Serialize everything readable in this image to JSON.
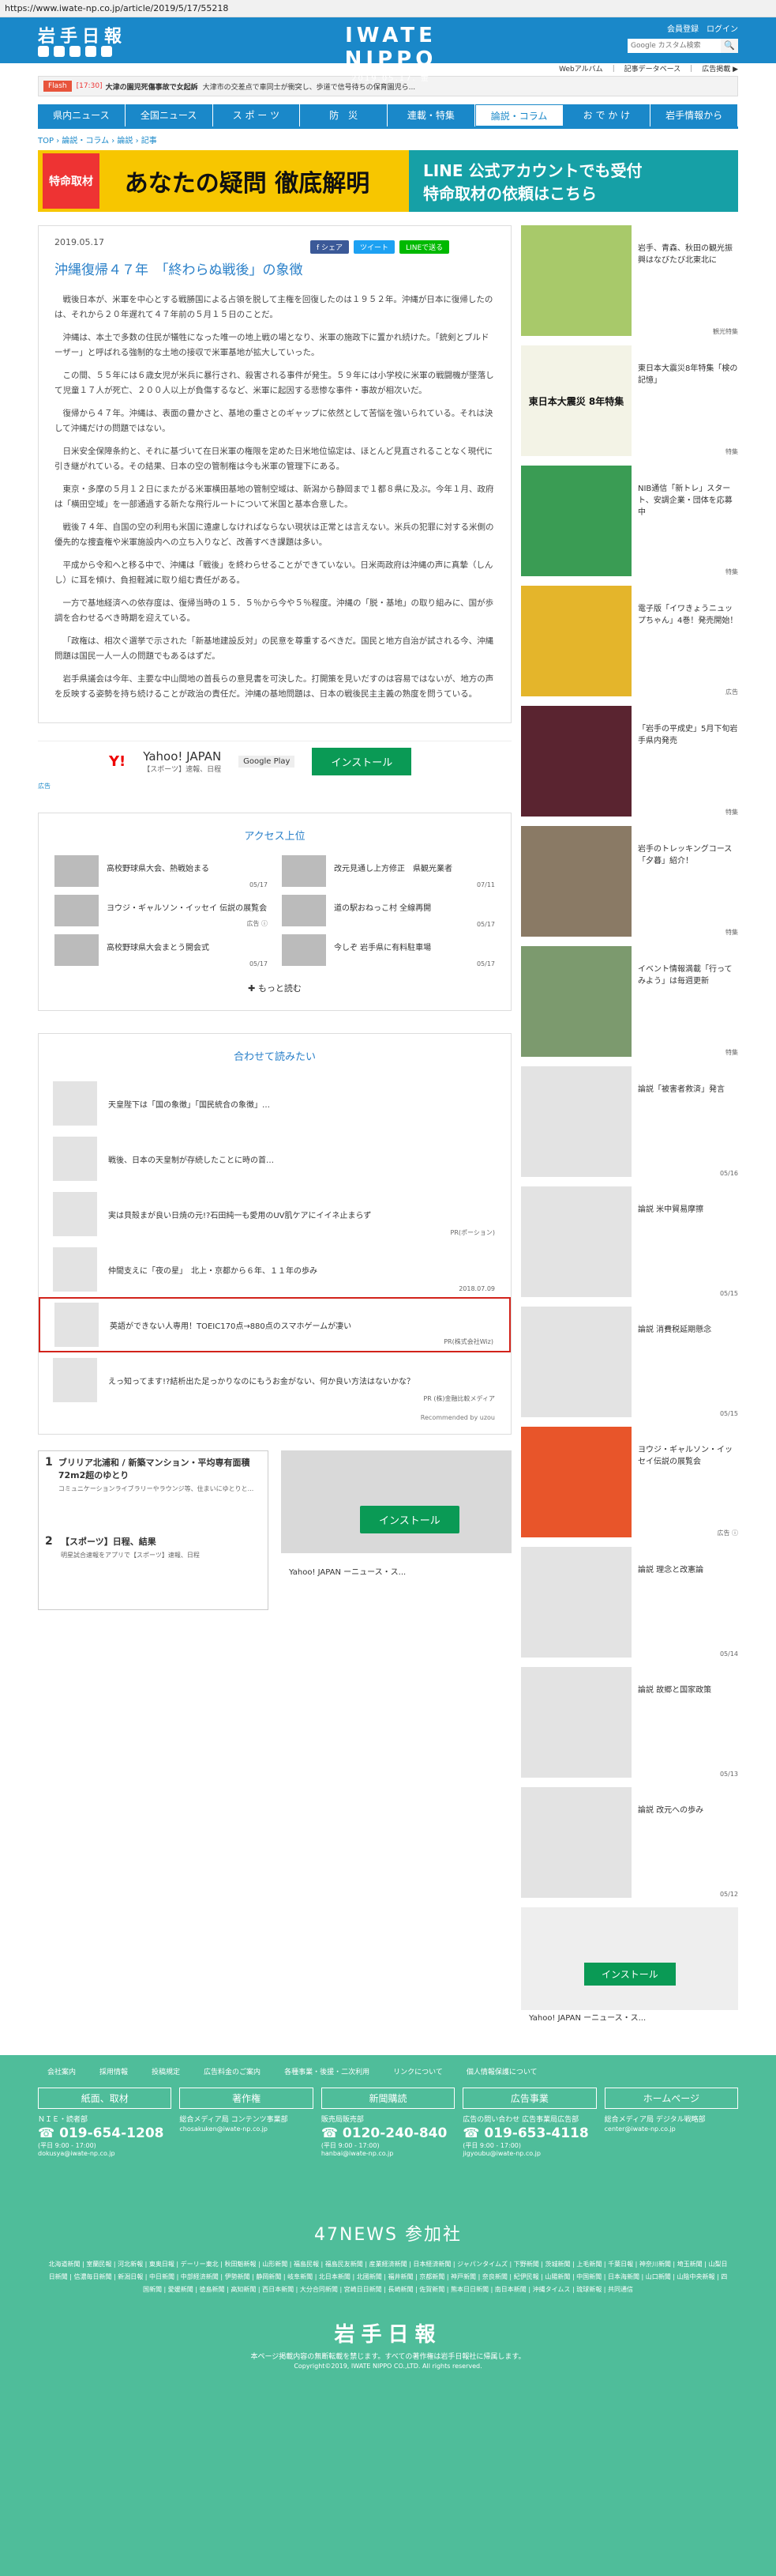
{
  "url": "https://www.iwate-np.co.jp/article/2019/5/17/55218",
  "header": {
    "logo": "岩手日報",
    "name": "IWATE NIPPO",
    "date": "2019.05.17. 金",
    "member": "会員登録　ログイン",
    "search_placeholder": "Google カスタム検索",
    "search_btn": "🔍"
  },
  "subbar": "Webアルバム　｜　記事データベース　｜　広告掲載 ▶",
  "flash": {
    "tag": "Flash",
    "time": "[17:30]",
    "title": "大津の園児死傷事故で女起訴",
    "body": "大津市の交差点で車同士が衝突し、歩道で信号待ちの保育園児ら..."
  },
  "nav": [
    {
      "label": "県内ニュース"
    },
    {
      "label": "全国ニュース"
    },
    {
      "label": "ス ポ ー ツ"
    },
    {
      "label": "防　災"
    },
    {
      "label": "連載・特集"
    },
    {
      "label": "論説・コラム",
      "active": true
    },
    {
      "label": "お で か け"
    },
    {
      "label": "岩手情報から"
    }
  ],
  "breadcrumb": "TOP › 論説・コラム › 論説 › 記事",
  "banner": {
    "q": "特命取材",
    "main": "あなたの疑問 徹底解明",
    "r1": "LINE 公式アカウントでも受付",
    "r2": "特命取材の依頼はこちら"
  },
  "article": {
    "date": "2019.05.17",
    "share": [
      "f シェア",
      "ツイート",
      "LINEで送る"
    ],
    "title": "沖縄復帰４７年　「終わらぬ戦後」の象徴",
    "paras": [
      "戦後日本が、米軍を中心とする戦勝国による占領を脱して主権を回復したのは１９５２年。沖縄が日本に復帰したのは、それから２０年遅れて４７年前の５月１５日のことだ。",
      "沖縄は、本土で多数の住民が犠牲になった唯一の地上戦の場となり、米軍の施政下に置かれ続けた。「銃剣とブルドーザー」と呼ばれる強制的な土地の接収で米軍基地が拡大していった。",
      "この間、５５年には６歳女児が米兵に暴行され、殺害される事件が発生。５９年には小学校に米軍の戦闘機が墜落して児童１７人が死亡、２００人以上が負傷するなど、米軍に起因する悲惨な事件・事故が相次いだ。",
      "復帰から４７年。沖縄は、表面の豊かさと、基地の重さとのギャップに依然として苦悩を強いられている。それは決して沖縄だけの問題ではない。",
      "日米安全保障条約と、それに基づいて在日米軍の権限を定めた日米地位協定は、ほとんど見直されることなく現代に引き継がれている。その結果、日本の空の管制権は今も米軍の管理下にある。",
      "東京・多摩の５月１２日にまたがる米軍横田基地の管制空域は、新潟から静岡まで１都８県に及ぶ。今年１月、政府は「横田空域」を一部通過する新たな飛行ルートについて米国と基本合意した。",
      "戦後７４年、自国の空の利用も米国に遠慮しなければならない現状は正常とは言えない。米兵の犯罪に対する米側の優先的な捜査権や米軍施設内への立ち入りなど、改善すべき課題は多い。",
      "平成から令和へと移る中で、沖縄は「戦後」を終わらせることができていない。日米両政府は沖縄の声に真摯（しんし）に耳を傾け、負担軽減に取り組む責任がある。",
      "一方で基地経済への依存度は、復帰当時の１５．５％から今や５％程度。沖縄の「脱・基地」の取り組みに、国が歩調を合わせるべき時期を迎えている。",
      "「政権は、相次ぐ選挙で示された「新基地建設反対」の民意を尊重するべきだ。国民と地方自治が試される今、沖縄問題は国民一人一人の問題でもあるはずだ。",
      "岩手県議会は今年、主要な中山間地の首長らの意見書を可決した。打開策を見いだすのは容易ではないが、地方の声を反映する姿勢を持ち続けることが政治の責任だ。沖縄の基地問題は、日本の戦後民主主義の熟度を問うている。"
    ]
  },
  "ad1": {
    "brand": "Y!",
    "title": "Yahoo! JAPAN",
    "sub": "【スポーツ】速報、日程",
    "gp": "Google Play",
    "install": "インストール",
    "label": "広告"
  },
  "access": {
    "heading": "アクセス上位",
    "items": [
      {
        "text": "高校野球県大会、熱戦始まる",
        "date": "05/17"
      },
      {
        "text": "改元見通し上方修正　県観光業者",
        "date": "07/11"
      },
      {
        "text": "ヨウジ・ギャルソン・イッセイ 伝説の展覧会",
        "date": "広告 ⓘ"
      },
      {
        "text": "道の駅おねっこ村 全線再開",
        "date": "05/17"
      },
      {
        "text": "高校野球県大会まとう開会式",
        "date": "05/17"
      },
      {
        "text": "今しぞ 岩手県に有料駐車場",
        "date": "05/17"
      }
    ],
    "more": "✚ もっと読む"
  },
  "related": {
    "heading": "合わせて読みたい",
    "items": [
      {
        "text": "天皇陛下は「国の象徴」「国民統合の象徴」…",
        "sponsor": ""
      },
      {
        "text": "戦後、日本の天皇制が存続したことに時の首…",
        "sponsor": ""
      },
      {
        "text": "実は貝殻まが良い日焼の元!?石田純一も愛用のUV肌ケアにイイネ止まらず",
        "sponsor": "PR(ポーション)"
      },
      {
        "text": "仲間支えに「夜の星」　北上・京都から６年、１１年の歩み",
        "sponsor": "2018.07.09"
      },
      {
        "text": "英語ができない人専用！TOEIC170点→880点のスマホゲームが凄い",
        "sponsor": "PR(株式会社Wiz)",
        "highlight": true
      },
      {
        "text": "えっ知ってます!?結析出た足っかりなのにもうお金がない、何か良い方法はないかな？",
        "sponsor": "PR (株)金融比較メディア"
      }
    ],
    "credit": "Recommended by uzou"
  },
  "lowads": {
    "l1n": "1",
    "l1t": "ブリリア北浦和 / 新築マンション・平均専有面積72m2超のゆとり",
    "l1s": "コミュニケーションライブラリーやラウンジ等、住まいにゆとりと...",
    "l2n": "2",
    "l2t": "【スポーツ】日程、結果",
    "l2s": "明星試合速報をアプリで【スポーツ】速報、日程",
    "r_install": "インストール",
    "r_title": "Yahoo! JAPAN ーニュース・ス..."
  },
  "side": [
    {
      "text": "岩手、青森、秋田の観光振興はなびたび北東北に",
      "tag": "観光特集"
    },
    {
      "text": "東日本大震災8年特集「検の記憶」",
      "tag": "特集",
      "label": "東日本大震災 8年特集"
    },
    {
      "text": "NIB通信「新トレ」スタート、安調企業・団体を応募中",
      "tag": "特集"
    },
    {
      "text": "電子版「イワきょうニュップちゃん」4巻！発売開始！",
      "tag": "広告"
    },
    {
      "text": "「岩手の平成史」5月下旬岩手県内発売",
      "tag": "特集"
    },
    {
      "text": "岩手のトレッキングコース「夕暮」紹介！",
      "tag": "特集"
    },
    {
      "text": "イベント情報満載「行ってみよう」は毎週更新",
      "tag": "特集"
    },
    {
      "text": "論説「被害者救済」発言",
      "tag": "05/16"
    },
    {
      "text": "論説 米中貿易摩擦",
      "tag": "05/15"
    },
    {
      "text": "論説 消費税延期懸念",
      "tag": "05/15"
    },
    {
      "text": "ヨウジ・ギャルソン・イッセイ伝説の展覧会",
      "tag": "広告 ⓘ"
    },
    {
      "text": "論説 理念と改憲論",
      "tag": "05/14"
    },
    {
      "text": "論説 故郷と国家政策",
      "tag": "05/13"
    },
    {
      "text": "論説 改元への歩み",
      "tag": "05/12"
    }
  ],
  "side_ad": {
    "install": "インストール",
    "title": "Yahoo! JAPAN ーニュース・ス..."
  },
  "footer": {
    "links": [
      "会社案内",
      "採用情報",
      "投稿規定",
      "広告料金のご案内",
      "各種事業・後援・二次利用",
      "リンクについて",
      "個人情報保護について"
    ],
    "contacts": [
      {
        "head": "紙面、取材",
        "line": "ＮＩＥ・読者部",
        "phone": "☎ 019-654-1208",
        "hours": "(平日 9:00 - 17:00)",
        "mail": "dokusya@iwate-np.co.jp"
      },
      {
        "head": "著作権",
        "line": "総合メディア局 コンテンツ事業部",
        "phone": "",
        "hours": "",
        "mail": "chosakuken@iwate-np.co.jp"
      },
      {
        "head": "新聞購読",
        "line": "販売局販売部",
        "phone": "☎ 0120-240-840",
        "hours": "(平日 9:00 - 17:00)",
        "mail": "hanbai@iwate-np.co.jp"
      },
      {
        "head": "広告事業",
        "line": "広告の問い合わせ 広告事業局広告部",
        "phone": "☎ 019-653-4118",
        "hours": "(平日 9:00 - 17:00)",
        "mail": "jigyoubu@iwate-np.co.jp"
      },
      {
        "head": "ホームページ",
        "line": "総合メディア局 デジタル戦略部",
        "phone": "",
        "hours": "",
        "mail": "center@iwate-np.co.jp"
      }
    ],
    "n47": "47NEWS 参加社",
    "n47list": "北海道新聞 | 室蘭民報 | 河北新報 | 東奥日報 | デーリー東北 | 秋田魁新報 | 山形新聞 | 福島民報 | 福島民友新聞 | 産業経済新聞 | 日本経済新聞 | ジャパンタイムズ | 下野新聞 | 茨城新聞 | 上毛新聞 | 千葉日報 | 神奈川新聞 | 埼玉新聞 | 山梨日日新聞 | 信濃毎日新聞 | 新潟日報 | 中日新聞 | 中部経済新聞 | 伊勢新聞 | 静岡新聞 | 岐阜新聞 | 北日本新聞 | 北國新聞 | 福井新聞 | 京都新聞 | 神戸新聞 | 奈良新聞 | 紀伊民報 | 山陽新聞 | 中国新聞 | 日本海新聞 | 山口新聞 | 山陰中央新報 | 四国新聞 | 愛媛新聞 | 徳島新聞 | 高知新聞 | 西日本新聞 | 大分合同新聞 | 宮崎日日新聞 | 長崎新聞 | 佐賀新聞 | 熊本日日新聞 | 南日本新聞 | 沖縄タイムス | 琉球新報 | 共同通信",
    "logo": "岩手日報",
    "note": "本ページ掲載内容の無断転載を禁じます。すべての著作権は岩手日報社に帰属します。",
    "copy": "Copyright©2019, IWATE NIPPO CO.,LTD. All rights reserved."
  }
}
